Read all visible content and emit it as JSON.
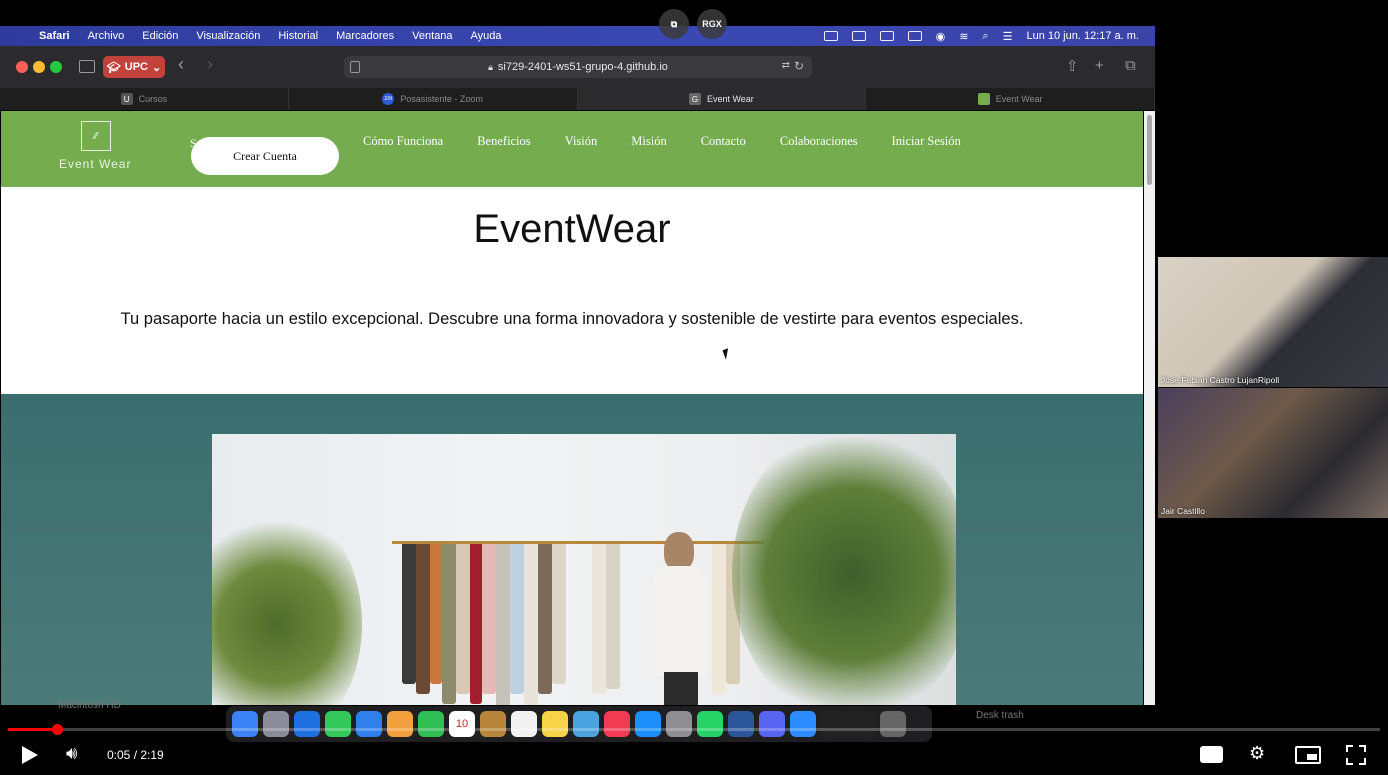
{
  "menubar": {
    "items": [
      "Safari",
      "Archivo",
      "Edición",
      "Visualización",
      "Historial",
      "Marcadores",
      "Ventana",
      "Ayuda"
    ],
    "clock": "Lun 10 jun.  12:17 a. m."
  },
  "overlay": {
    "rgx": "RGX"
  },
  "browser": {
    "profile": "UPC",
    "url": "si729-2401-ws51-grupo-4.github.io",
    "tabs": [
      {
        "label": "Cursos",
        "favicon": "U",
        "active": false
      },
      {
        "label": "Posasistente - Zoom",
        "favicon": "zm",
        "active": false
      },
      {
        "label": "Event Wear",
        "favicon": "G",
        "active": true
      },
      {
        "label": "Event Wear",
        "favicon": "",
        "active": false
      }
    ]
  },
  "site": {
    "logo_text": "Event Wear",
    "hidden_nav_fragment": "S",
    "cta": "Crear Cuenta",
    "nav": [
      "Cómo Funciona",
      "Beneficios",
      "Visión",
      "Misión",
      "Contacto",
      "Colaboraciones",
      "Iniciar Sesión"
    ],
    "title": "EventWear",
    "subtitle": "Tu pasaporte hacia un estilo excepcional. Descubre una forma innovadora y sostenible de vestirte para eventos especiales.",
    "colors": {
      "navbar": "#74ac4e",
      "hero_band": "#3a6e6e"
    }
  },
  "dock": {
    "calendar_day": "10",
    "left_label": "Macintosh HD",
    "right_label": "Desk trash"
  },
  "participants": [
    {
      "name": "Jose Fabian Castro LujanRipoll"
    },
    {
      "name": "Jair Castillo"
    }
  ],
  "player": {
    "time": "0:05 / 2:19",
    "progress": 0.036
  }
}
